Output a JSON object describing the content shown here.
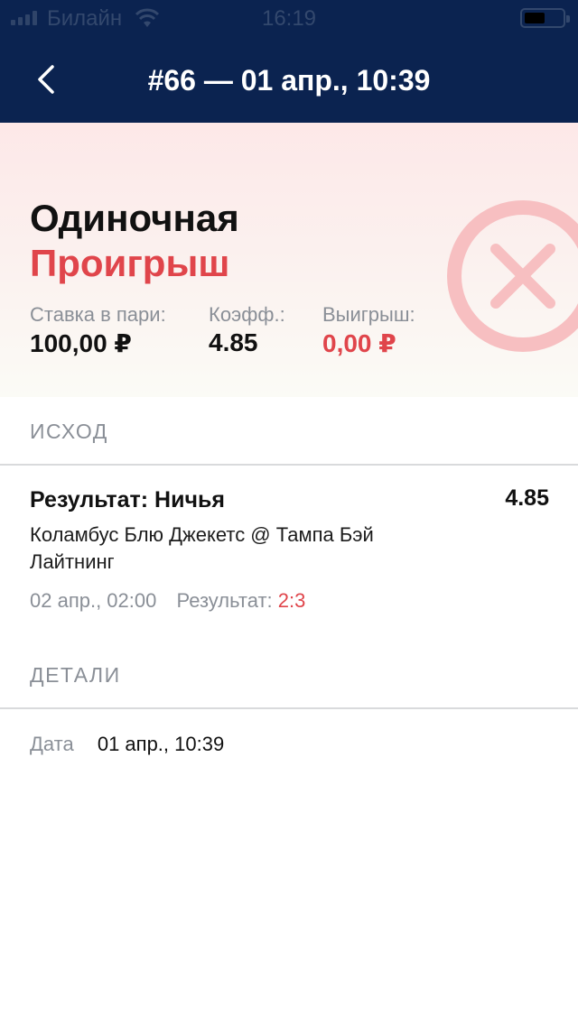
{
  "status_bar": {
    "carrier": "Билайн",
    "time": "16:19"
  },
  "nav": {
    "title": "#66 — 01 апр., 10:39",
    "back_icon": "chevron-left-icon"
  },
  "bet": {
    "type": "Одиночная",
    "status": "Проигрыш",
    "status_icon": "close-circle-icon",
    "stake_label": "Ставка в пари:",
    "stake_value": "100,00 ₽",
    "odds_label": "Коэфф.:",
    "odds_value": "4.85",
    "payout_label": "Выигрыш:",
    "payout_value": "0,00 ₽"
  },
  "outcome": {
    "header": "ИСХОД",
    "title": "Результат: Ничья",
    "odds": "4.85",
    "event": "Коламбус Блю Джекетс @ Тампа Бэй Лайтнинг",
    "date": "02 апр., 02:00",
    "result_label": "Результат:",
    "result_score": "2:3"
  },
  "details": {
    "header": "ДЕТАЛИ",
    "date_label": "Дата",
    "date_value": "01 апр., 10:39"
  },
  "colors": {
    "navy": "#0b2350",
    "loss_red": "#e0454b",
    "loss_icon_pink": "#f7bfc1",
    "muted_gray": "#8a8f97"
  }
}
